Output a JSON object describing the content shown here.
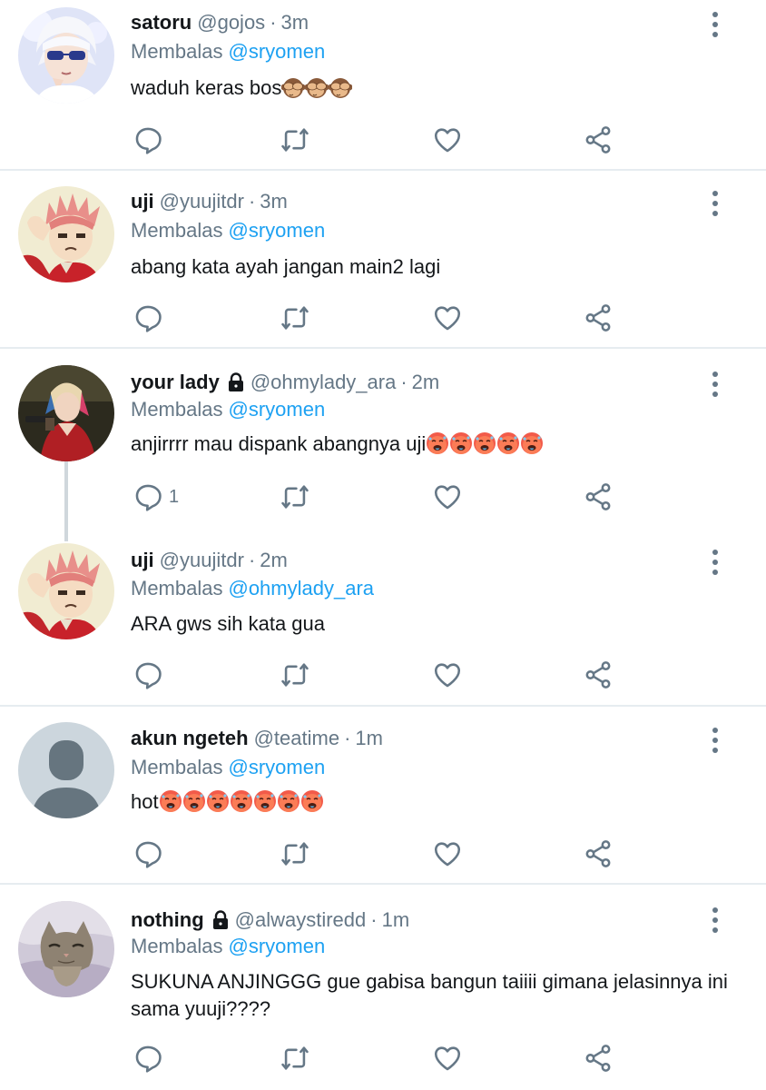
{
  "reply_prefix": "Membalas",
  "separator": "·",
  "tweets": [
    {
      "name": "satoru",
      "handle": "@gojos",
      "time": "3m",
      "locked": false,
      "reply_to": "@sryomen",
      "text": "waduh keras bos",
      "emoji": [
        "see-no-evil-monkey",
        "see-no-evil-monkey",
        "see-no-evil-monkey"
      ],
      "reply_count": "",
      "avatar": "anime-white-hair-sunglasses"
    },
    {
      "name": "uji",
      "handle": "@yuujitdr",
      "time": "3m",
      "locked": false,
      "reply_to": "@sryomen",
      "text": "abang kata ayah jangan main2 lagi",
      "emoji": [],
      "reply_count": "",
      "avatar": "anime-pink-hair-salute"
    },
    {
      "name": "your lady",
      "handle": "@ohmylady_ara",
      "time": "2m",
      "locked": true,
      "reply_to": "@sryomen",
      "text": "anjirrrr mau dispank abangnya uji",
      "emoji": [
        "hot-face",
        "hot-face",
        "hot-face",
        "hot-face",
        "hot-face"
      ],
      "reply_count": "1",
      "avatar": "woman-red-outfit"
    },
    {
      "name": "uji",
      "handle": "@yuujitdr",
      "time": "2m",
      "locked": false,
      "reply_to": "@ohmylady_ara",
      "text": "ARA gws sih kata gua",
      "emoji": [],
      "reply_count": "",
      "avatar": "anime-pink-hair-salute"
    },
    {
      "name": "akun ngeteh",
      "handle": "@teatime",
      "time": "1m",
      "locked": false,
      "reply_to": "@sryomen",
      "text": "hot",
      "emoji": [
        "hot-face",
        "hot-face",
        "hot-face",
        "hot-face",
        "hot-face",
        "hot-face",
        "hot-face"
      ],
      "reply_count": "",
      "avatar": "default-silhouette"
    },
    {
      "name": "nothing",
      "handle": "@alwaystiredd",
      "time": "1m",
      "locked": true,
      "reply_to": "@sryomen",
      "text": "SUKUNA ANJINGGG gue gabisa bangun taiiii gimana jelasinnya ini sama yuuji????",
      "emoji": [],
      "reply_count": "",
      "avatar": "tired-cat"
    }
  ],
  "icons": {
    "reply": "reply-icon",
    "retweet": "retweet-icon",
    "like": "heart-icon",
    "share": "share-icon",
    "more": "more-vertical-icon",
    "lock": "lock-icon"
  },
  "colors": {
    "name": "#14171a",
    "secondary": "#657786",
    "mention": "#1da1f2",
    "divider": "#e6ecf0"
  }
}
